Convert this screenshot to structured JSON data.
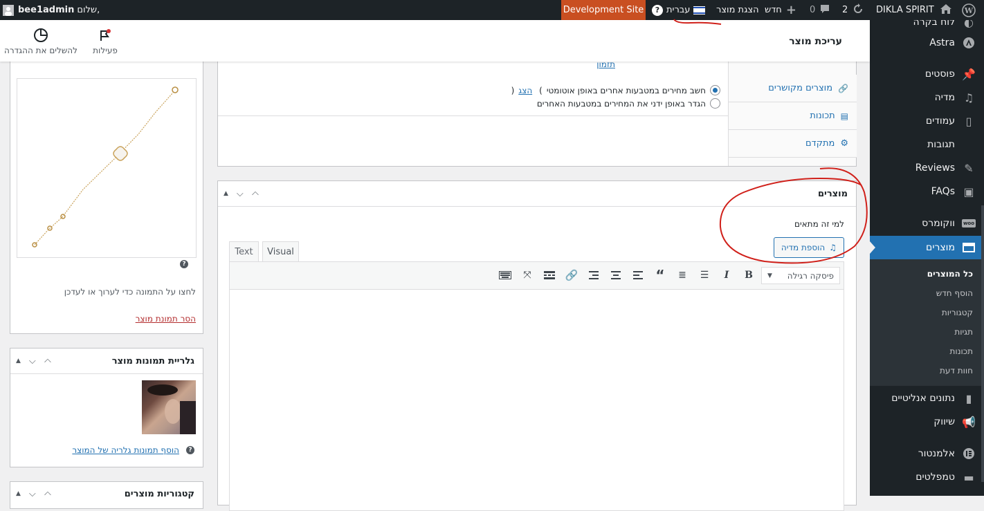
{
  "adminbar": {
    "greeting": "שלום,",
    "username": "bee1admin",
    "dev_site": "Development Site",
    "language": "עברית",
    "view_product": "הצגת מוצר",
    "new": "חדש",
    "comments_count": "0",
    "updates_count": "2",
    "site_name": "DIKLA SPIRIT"
  },
  "header": {
    "title": "עריכת מוצר",
    "activity": "פעילות",
    "finish_setup": "להשלים את ההגדרה"
  },
  "sidebar": {
    "top_partial": "לוח בקרה",
    "items": [
      {
        "label": "Astra",
        "icon": "astra-icon"
      },
      {
        "label": "פוסטים",
        "icon": "pin-icon"
      },
      {
        "label": "מדיה",
        "icon": "media-icon"
      },
      {
        "label": "עמודים",
        "icon": "pages-icon"
      },
      {
        "label": "תגובות",
        "icon": "comments-icon"
      },
      {
        "label": "Reviews",
        "icon": "pin-icon"
      },
      {
        "label": "FAQs",
        "icon": "faq-icon"
      },
      {
        "label": "ווקומרס",
        "icon": "woo-icon"
      },
      {
        "label": "מוצרים",
        "icon": "products-icon"
      }
    ],
    "submenu": [
      "כל המוצרים",
      "הוסף חדש",
      "קטגוריות",
      "תגיות",
      "תכונות",
      "חוות דעת"
    ],
    "items_after": [
      {
        "label": "נתונים אנליטיים",
        "icon": "analytics-icon"
      },
      {
        "label": "שיווק",
        "icon": "megaphone-icon"
      },
      {
        "label": "אלמנטור",
        "icon": "elementor-icon"
      },
      {
        "label": "טמפלטים",
        "icon": "folder-icon"
      }
    ]
  },
  "product_data": {
    "schedule_link": "תזמון",
    "radio_auto": "חשב מחירים במטבעות אחרים באופן אוטומטי",
    "radio_auto_link": "הצג",
    "radio_manual": "הגדר באופן ידני את המחירים במטבעות האחרים",
    "tabs": [
      "מוצרים מקושרים",
      "תכונות",
      "מתקדם"
    ]
  },
  "editor": {
    "title": "מוצרים",
    "label": "למי זה מתאים",
    "add_media": "הוספת מדיה",
    "tab_visual": "Visual",
    "tab_text": "Text",
    "format_select": "פיסקה רגילה"
  },
  "product_image": {
    "help": "?",
    "instruction": "לחצו על התמונה כדי לערוך או לעדכן",
    "remove_link": "הסר תמונת מוצר"
  },
  "gallery": {
    "title": "גלריית תמונות מוצר",
    "add_link": "הוסף תמונות גלריה של המוצר",
    "help": "?"
  },
  "categories": {
    "title": "קטגוריות מוצרים"
  }
}
